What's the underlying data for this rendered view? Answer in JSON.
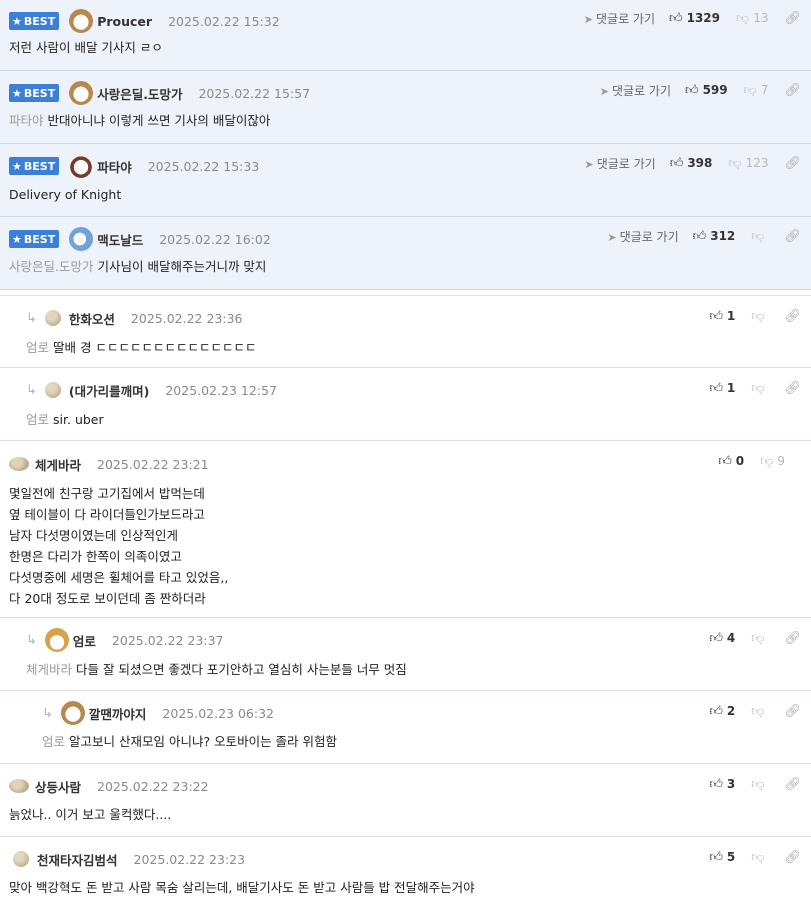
{
  "labels": {
    "best": "BEST",
    "goto": "댓글로 가기"
  },
  "comments": [
    {
      "nick": "Proucer",
      "date": "2025.02.22 15:32",
      "mention": "",
      "text": [
        "저런 사람이 배달 기사지 ㄹㅇ"
      ],
      "likes": "1329",
      "dislikes": "13"
    },
    {
      "nick": "사랑은딜.도망가",
      "date": "2025.02.22 15:57",
      "mention": "파타야",
      "text": [
        "반대아니냐 이렇게 쓰면 기사의 배달이잖아"
      ],
      "likes": "599",
      "dislikes": "7"
    },
    {
      "nick": "파타야",
      "date": "2025.02.22 15:33",
      "mention": "",
      "text": [
        "Delivery of Knight"
      ],
      "likes": "398",
      "dislikes": "123"
    },
    {
      "nick": "맥도날드",
      "date": "2025.02.22 16:02",
      "mention": "사랑은딜.도망가",
      "text": [
        "기사님이 배달해주는거니까 맞지"
      ],
      "likes": "312",
      "dislikes": ""
    },
    {
      "nick": "한화오션",
      "date": "2025.02.22 23:36",
      "mention": "엄로",
      "text": [
        "딸배 경 ㄷㄷㄷㄷㄷㄷㄷㄷㄷㄷㄷㄷㄷㄷ"
      ],
      "likes": "1",
      "dislikes": ""
    },
    {
      "nick": "(대가리를깨며)",
      "date": "2025.02.23 12:57",
      "mention": "엄로",
      "text": [
        "sir. uber"
      ],
      "likes": "1",
      "dislikes": ""
    },
    {
      "nick": "체게바라",
      "date": "2025.02.22 23:21",
      "mention": "",
      "text": [
        "몇일전에 친구랑 고기집에서 밥먹는데",
        "옆 테이블이 다 라이더들인가보드라고",
        "남자 다섯명이였는데 인상적인게",
        "한명은 다리가 한쪽이 의족이였고",
        "다섯명중에 세명은 휠체어를 타고 있었음,,",
        "다 20대 정도로 보이던데 좀 짠하더라"
      ],
      "likes": "0",
      "dislikes": "9"
    },
    {
      "nick": "엄로",
      "date": "2025.02.22 23:37",
      "mention": "체게바라",
      "text": [
        "다들 잘 되셨으면 좋겠다 포기안하고 열심히 사는분들 너무 멋짐"
      ],
      "likes": "4",
      "dislikes": ""
    },
    {
      "nick": "깔땐까야지",
      "date": "2025.02.23 06:32",
      "mention": "엄로",
      "text": [
        "알고보니 산재모임 아니냐? 오토바이는 졸라 위험함"
      ],
      "likes": "2",
      "dislikes": ""
    },
    {
      "nick": "상등사람",
      "date": "2025.02.22 23:22",
      "mention": "",
      "text": [
        "늙었나.. 이거 보고 울컥했다...."
      ],
      "likes": "3",
      "dislikes": ""
    },
    {
      "nick": "천재타자김범석",
      "date": "2025.02.22 23:23",
      "mention": "",
      "text": [
        "맞아 백강혁도 돈 받고 사람 목숨 살리는데, 배달기사도 돈 받고 사람들 밥 전달해주는거야"
      ],
      "likes": "5",
      "dislikes": ""
    }
  ]
}
